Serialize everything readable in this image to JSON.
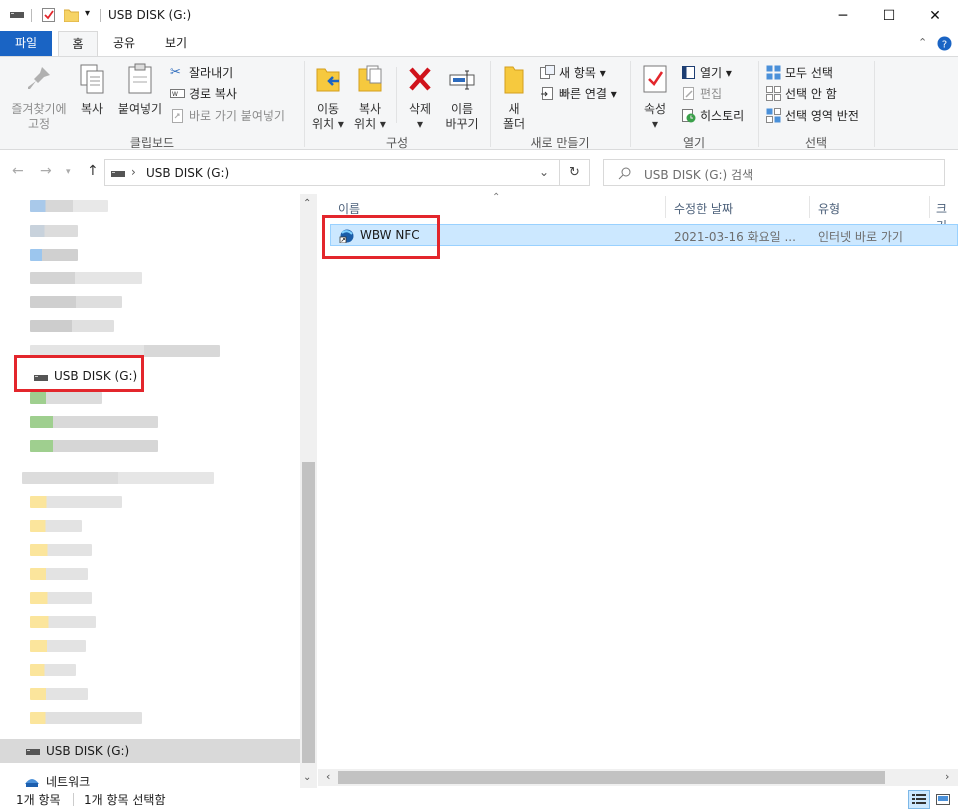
{
  "window": {
    "title": "USB DISK (G:)",
    "controls": [
      "─",
      "☐",
      "✕"
    ]
  },
  "tabs": [
    {
      "label": "파일"
    },
    {
      "label": "홈"
    },
    {
      "label": "공유"
    },
    {
      "label": "보기"
    }
  ],
  "ribbon": {
    "clipboard": {
      "pin_line1": "즐겨찾기에",
      "pin_line2": "고정",
      "copy": "복사",
      "paste": "붙여넣기",
      "cut": "잘라내기",
      "copy_path": "경로 복사",
      "paste_shortcut": "바로 가기 붙여넣기",
      "group": "클립보드"
    },
    "organize": {
      "move_line1": "이동",
      "move_line2": "위치 ▾",
      "copy_line1": "복사",
      "copy_line2": "위치 ▾",
      "delete_line1": "삭제",
      "delete_line2": "▾",
      "rename_line1": "이름",
      "rename_line2": "바꾸기",
      "group": "구성"
    },
    "new": {
      "folder_line1": "새",
      "folder_line2": "폴더",
      "new_item": "새 항목 ▾",
      "easy_access": "빠른 연결 ▾",
      "group": "새로 만들기"
    },
    "open": {
      "properties": "속성",
      "properties_arrow": "▾",
      "open": "열기 ▾",
      "edit": "편집",
      "history": "히스토리",
      "group": "열기"
    },
    "select": {
      "select_all": "모두 선택",
      "select_none": "선택 안 함",
      "invert": "선택 영역 반전",
      "group": "선택"
    }
  },
  "address": {
    "path": "USB DISK (G:)",
    "search_placeholder": "USB DISK (G:) 검색"
  },
  "nav": {
    "selected_item": "USB DISK (G:)",
    "bottom_item": "USB DISK (G:)",
    "network": "네트워크"
  },
  "columns": [
    "이름",
    "수정한 날짜",
    "유형",
    "크기"
  ],
  "files": [
    {
      "name": "WBW NFC",
      "modified": "2021-03-16 화요일 ...",
      "type": "인터넷 바로 가기"
    }
  ],
  "status": {
    "count": "1개 항목",
    "selected": "1개 항목 선택함"
  },
  "colors": {
    "file_tab": "#1a64c4",
    "selection": "#cce8ff",
    "highlight_box": "#e3262c"
  }
}
